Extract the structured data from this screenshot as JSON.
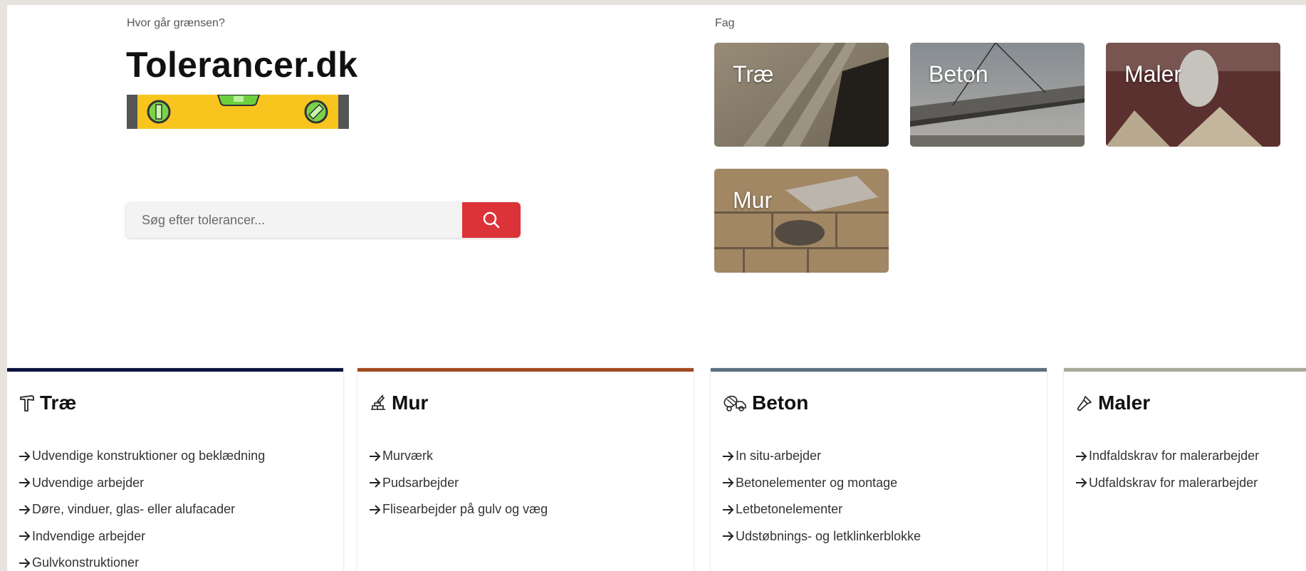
{
  "hero": {
    "tagline": "Hvor går grænsen?",
    "title": "Tolerancer.dk",
    "logo_icon": "spirit-level-icon",
    "search": {
      "placeholder": "Søg efter tolerancer...",
      "value": "",
      "button_icon": "search-icon"
    }
  },
  "fag": {
    "label": "Fag",
    "cards": [
      {
        "label": "Træ"
      },
      {
        "label": "Beton"
      },
      {
        "label": "Maler"
      },
      {
        "label": "Mur"
      }
    ]
  },
  "categories": [
    {
      "title": "Træ",
      "icon": "hammer-icon",
      "accent": "#0b1440",
      "items": [
        "Udvendige konstruktioner og beklædning",
        "Udvendige arbejder",
        "Døre, vinduer, glas- eller alufacader",
        "Indvendige arbejder",
        "Gulvkonstruktioner"
      ]
    },
    {
      "title": "Mur",
      "icon": "trowel-bricks-icon",
      "accent": "#a24a20",
      "items": [
        "Murværk",
        "Pudsarbejder",
        "Flisearbejder på gulv og væg"
      ]
    },
    {
      "title": "Beton",
      "icon": "cement-mixer-icon",
      "accent": "#5a6f80",
      "items": [
        "In situ-arbejder",
        "Betonelementer og montage",
        "Letbetonelementer",
        "Udstøbnings- og letklinkerblokke"
      ]
    },
    {
      "title": "Maler",
      "icon": "paint-brush-icon",
      "accent": "#a9a99a",
      "items": [
        "Indfaldskrav for malerarbejder",
        "Udfaldskrav for malerarbejder"
      ]
    }
  ],
  "colors": {
    "search_button": "#dc3338",
    "logo_yellow": "#f7c51e"
  }
}
